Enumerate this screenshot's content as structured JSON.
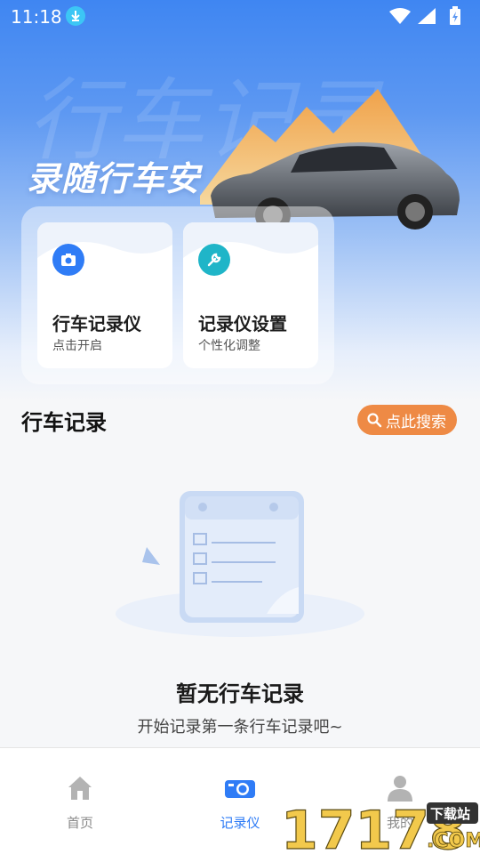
{
  "status_bar": {
    "time": "11:18"
  },
  "hero": {
    "watermark_text": "行车记录",
    "slogan": "录随行车安"
  },
  "feature_cards": [
    {
      "title": "行车记录仪",
      "subtitle": "点击开启",
      "icon": "camera-icon",
      "color": "#2f7cf6"
    },
    {
      "title": "记录仪设置",
      "subtitle": "个性化调整",
      "icon": "wrench-icon",
      "color": "#1fb5c8"
    }
  ],
  "records": {
    "title": "行车记录",
    "search_label": "点此搜索",
    "empty_title": "暂无行车记录",
    "empty_subtitle": "开始记录第一条行车记录吧~"
  },
  "tabs": [
    {
      "label": "首页",
      "icon": "home-icon",
      "active": false
    },
    {
      "label": "记录仪",
      "icon": "camera-icon",
      "active": true
    },
    {
      "label": "我的",
      "icon": "person-icon",
      "active": false
    }
  ],
  "watermark": {
    "number": "17178",
    "badge": "下载站",
    "suffix": ".COM"
  },
  "colors": {
    "accent": "#2f7cf6",
    "search": "#ee8a45",
    "teal": "#1fb5c8"
  }
}
